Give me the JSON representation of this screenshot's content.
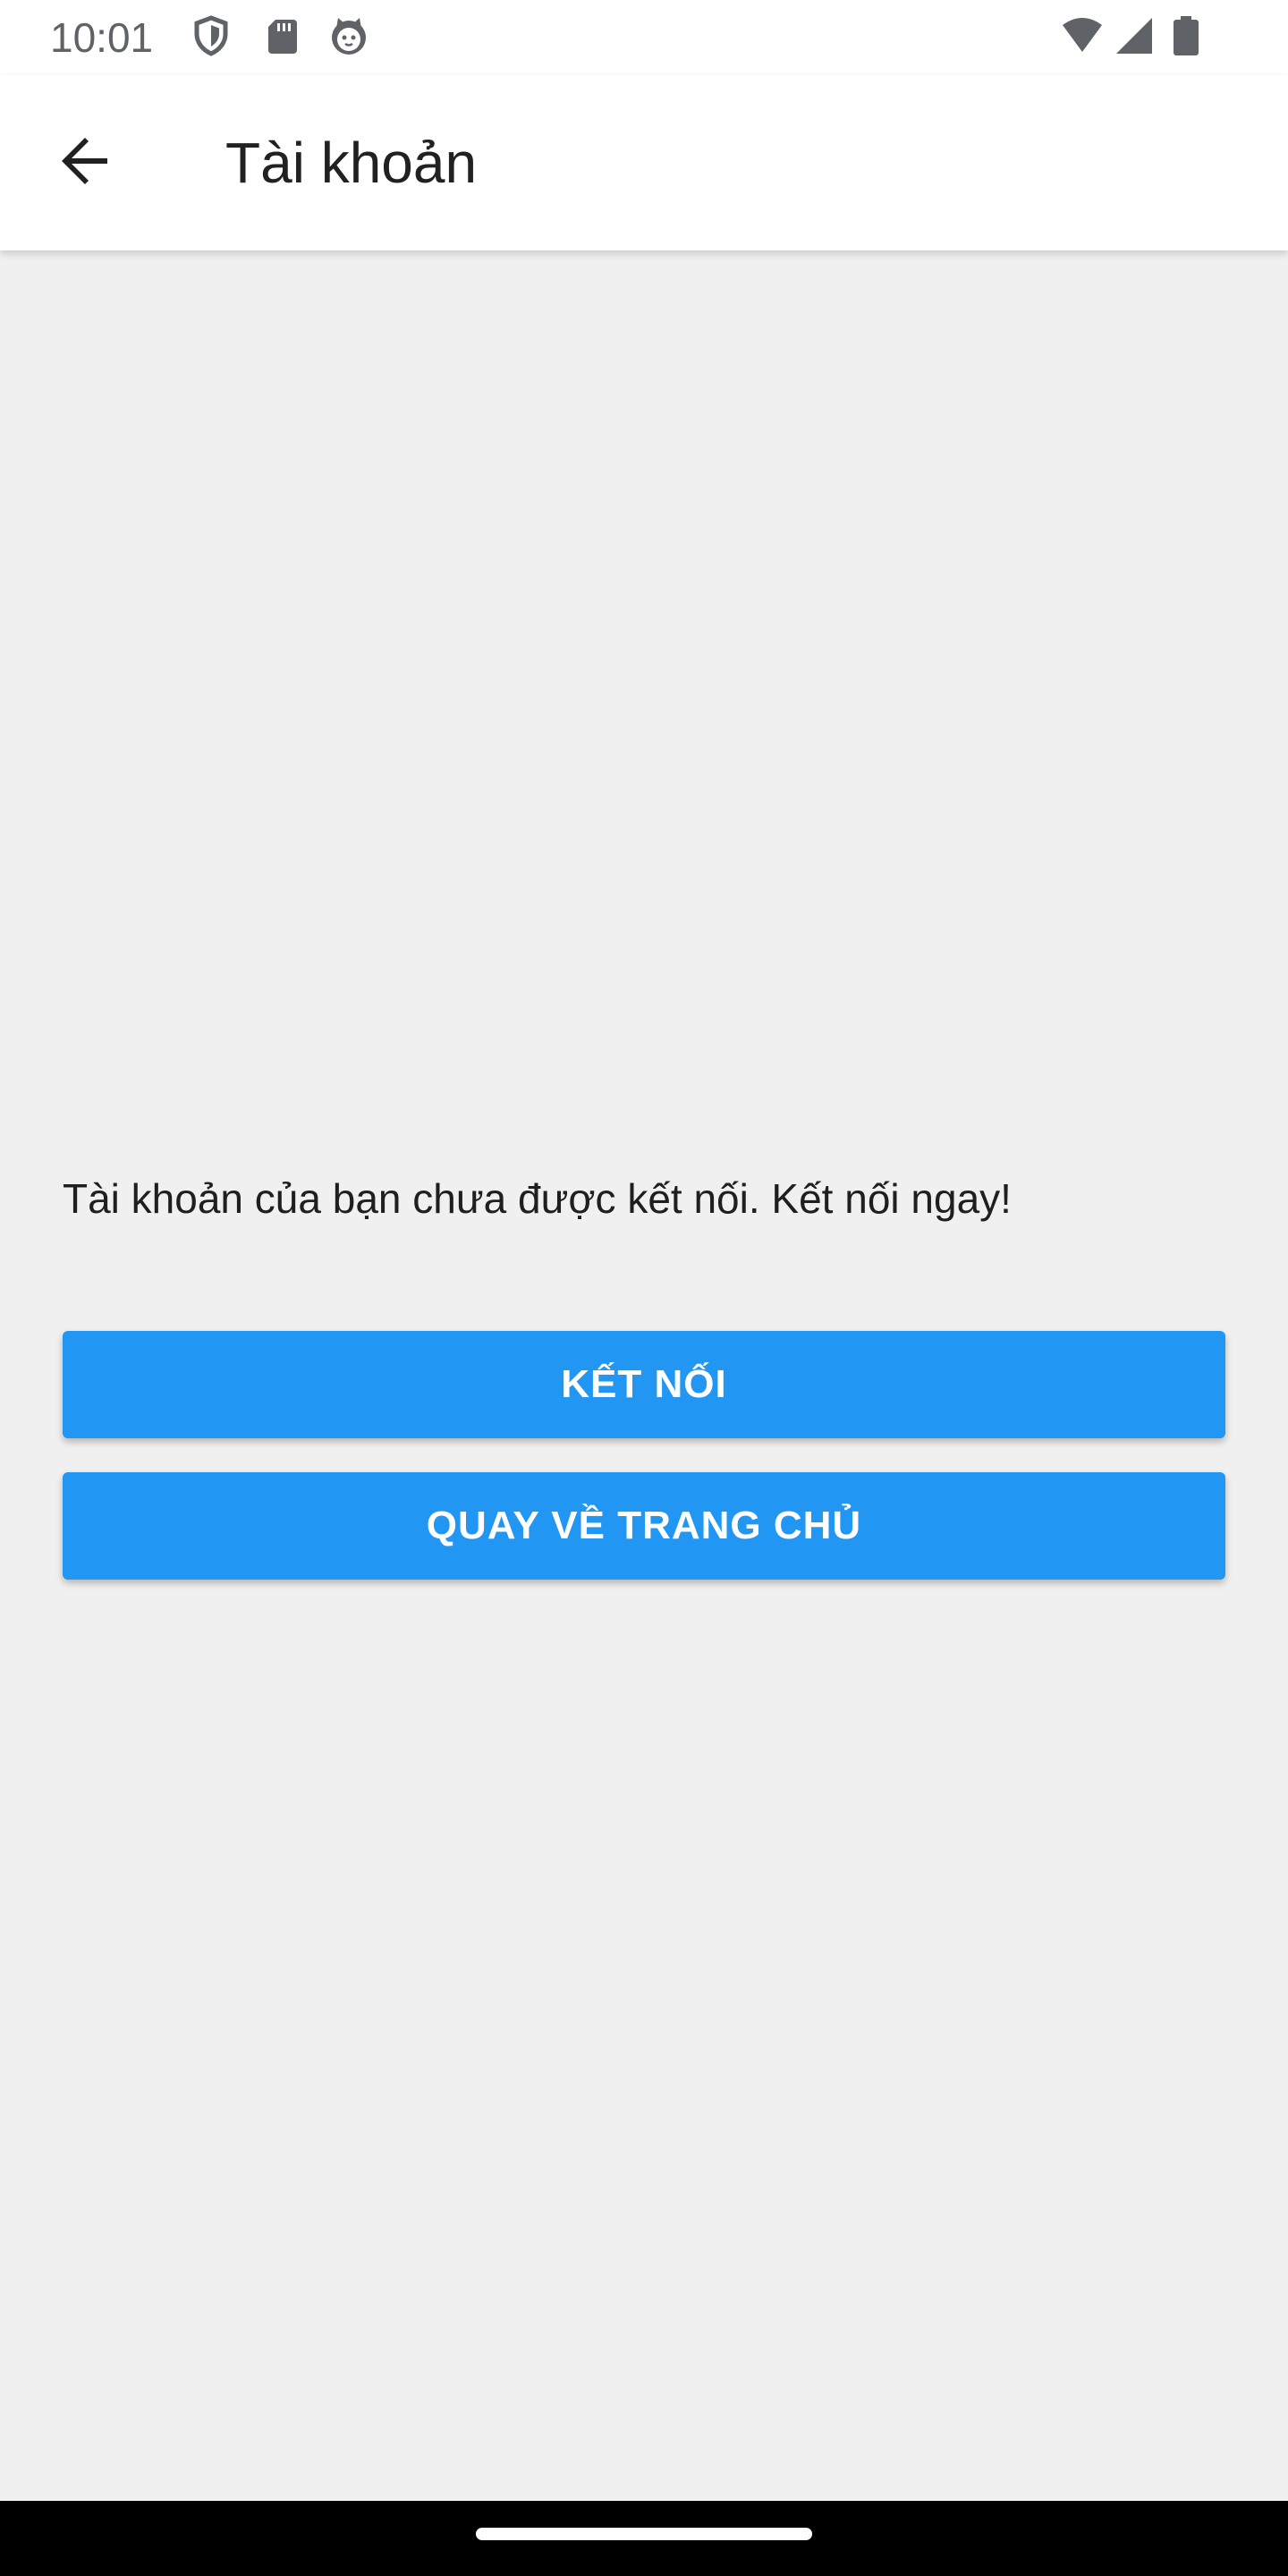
{
  "status_bar": {
    "time": "10:01",
    "left_icons": [
      "shield-icon",
      "sd-card-icon",
      "cat-face-icon"
    ],
    "right_icons": [
      "wifi-icon",
      "cellular-signal-icon",
      "battery-icon"
    ]
  },
  "app_bar": {
    "back_icon": "arrow-left-icon",
    "title": "Tài khoản"
  },
  "main": {
    "message": "Tài khoản của bạn chưa được kết nối. Kết nối ngay!",
    "connect_button_label": "KẾT NỐI",
    "home_button_label": "QUAY VỀ TRANG CHỦ"
  },
  "colors": {
    "primary_button": "#2196f3",
    "background": "#f0f0f0",
    "app_bar": "#ffffff",
    "nav_bar": "#000000"
  }
}
